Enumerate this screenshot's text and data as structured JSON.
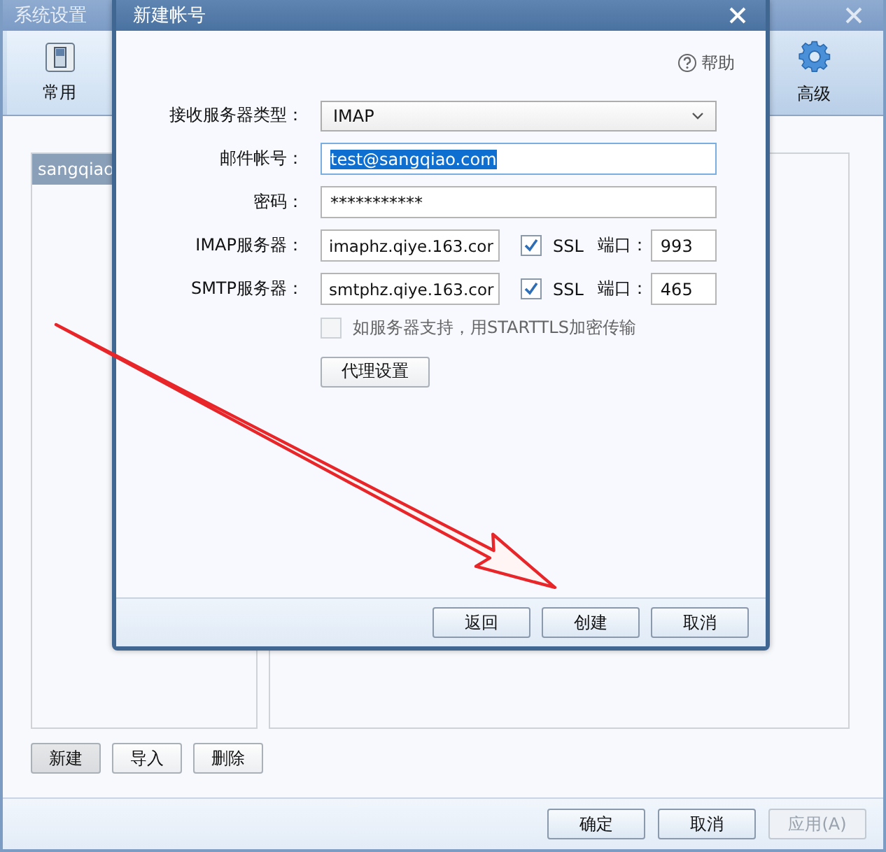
{
  "window": {
    "title": "系统设置"
  },
  "toolbar": [
    {
      "label": "常用",
      "kind": "switch",
      "selected": true
    },
    {
      "label": "高级",
      "kind": "gear",
      "selected": false
    }
  ],
  "account_list": {
    "items": [
      {
        "label": "sangqiao",
        "selected": true
      }
    ]
  },
  "list_buttons": [
    {
      "label": "新建",
      "pressed": true
    },
    {
      "label": "导入",
      "pressed": false
    },
    {
      "label": "删除",
      "pressed": false
    }
  ],
  "footer_buttons": [
    {
      "label": "确定",
      "disabled": false
    },
    {
      "label": "取消",
      "disabled": false
    },
    {
      "label": "应用(A)",
      "disabled": true
    }
  ],
  "dialog": {
    "title": "新建帐号",
    "help": "帮助",
    "fields": [
      {
        "kind": "select",
        "label": "接收服务器类型：",
        "value": "IMAP"
      },
      {
        "kind": "text",
        "label": "邮件帐号：",
        "value": "test@sangqiao.com",
        "selected": true
      },
      {
        "kind": "text",
        "label": "密码：",
        "value": "***********",
        "selected": false
      },
      {
        "kind": "server",
        "label": "IMAP服务器：",
        "value": "imaphz.qiye.163.cor",
        "ssl": {
          "label": "SSL",
          "checked": true
        },
        "port_label": "端口：",
        "port": "993"
      },
      {
        "kind": "server",
        "label": "SMTP服务器：",
        "value": "smtphz.qiye.163.cor",
        "ssl": {
          "label": "SSL",
          "checked": true
        },
        "port_label": "端口：",
        "port": "465"
      }
    ],
    "starttls": {
      "label": "如服务器支持，用STARTTLS加密传输",
      "checked": false,
      "disabled": true
    },
    "proxy_button": "代理设置",
    "buttons": [
      "返回",
      "创建",
      "取消"
    ]
  }
}
